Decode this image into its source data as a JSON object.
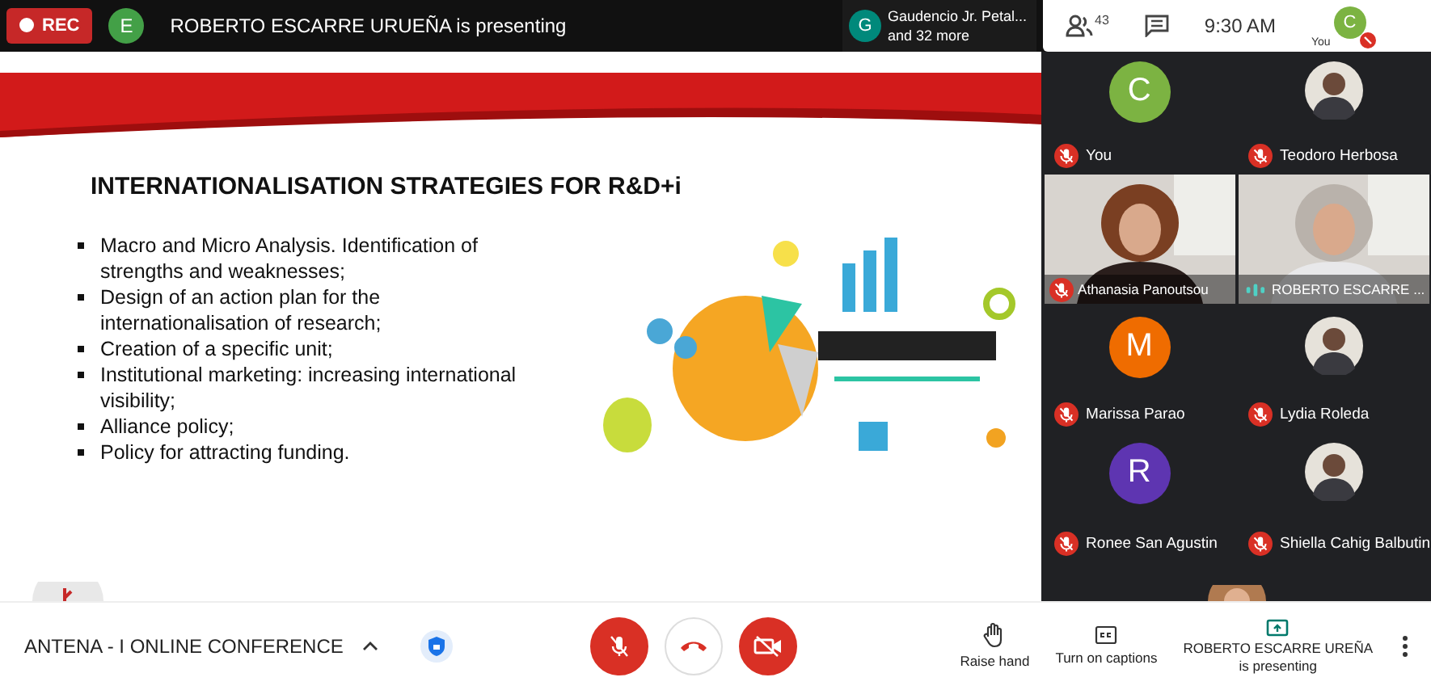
{
  "top_bar": {
    "recording": {
      "label": "REC"
    },
    "presenter": {
      "initial": "E",
      "color": "#43a047",
      "text": "ROBERTO ESCARRE URUEÑA is presenting"
    },
    "attendees_chip": {
      "initial": "G",
      "color": "#00897b",
      "name": "Gaudencio Jr. Petal...",
      "more": "and 32 more"
    },
    "people_count": "43",
    "time": "9:30 AM",
    "self": {
      "label": "You",
      "initial": "C",
      "color": "#7cb342",
      "muted": true
    }
  },
  "slide": {
    "title": "INTERNATIONALISATION STRATEGIES FOR R&D+i",
    "bullets": [
      "Macro and Micro Analysis. Identification of strengths and weaknesses;",
      "Design of an action plan for the internationalisation of research;",
      "Creation of a specific unit;",
      "Institutional marketing: increasing international visibility;",
      "Alliance policy;",
      "Policy for attracting funding."
    ]
  },
  "participants": [
    {
      "kind": "letter",
      "initial": "C",
      "color": "#7cb342",
      "name": "You",
      "muted": true
    },
    {
      "name": "Teodoro Herbosa",
      "muted": true
    },
    {
      "kind": "video",
      "name": "Athanasia Panoutsou",
      "muted": true
    },
    {
      "kind": "video",
      "name": "ROBERTO ESCARRE ...",
      "muted": false
    },
    {
      "kind": "letter",
      "initial": "M",
      "color": "#ef6c00",
      "name": "Marissa Parao",
      "muted": true
    },
    {
      "name": "Lydia Roleda",
      "muted": true
    },
    {
      "kind": "letter",
      "initial": "R",
      "color": "#5e35b1",
      "name": "Ronee San Agustin",
      "muted": true
    },
    {
      "name": "Shiella Cahig Balbutin",
      "muted": true
    },
    {
      "kind": "partial"
    }
  ],
  "bottom_bar": {
    "meeting_title": "ANTENA - I ONLINE CONFERENCE",
    "controls": [
      {
        "kind": "mic",
        "on": false
      },
      {
        "kind": "hangup"
      },
      {
        "kind": "camera",
        "on": false
      }
    ],
    "actions": [
      {
        "kind": "hand",
        "label": "Raise hand"
      },
      {
        "kind": "captions",
        "label": "Turn on captions"
      }
    ],
    "presenting": {
      "line1": "ROBERTO ESCARRE UREÑA",
      "line2": "is presenting"
    }
  }
}
